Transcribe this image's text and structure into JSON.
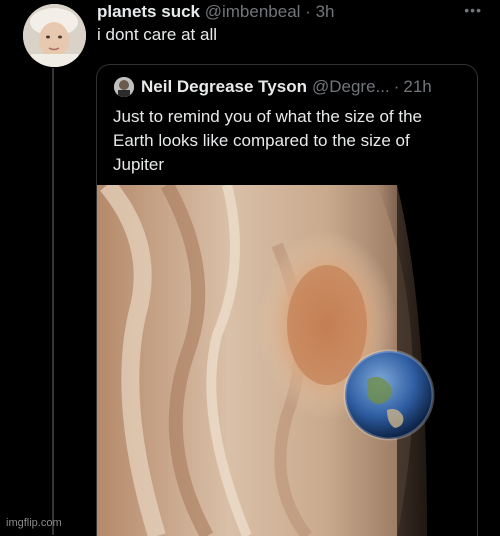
{
  "tweet": {
    "display_name": "planets suck",
    "handle": "@imbenbeal",
    "separator": "·",
    "time": "3h",
    "text": "i dont care at all",
    "more_icon": "more-dots-icon"
  },
  "quoted": {
    "display_name": "Neil Degrease Tyson",
    "handle": "@Degre...",
    "separator": "·",
    "time": "21h",
    "text": "Just to remind you of what the size of the Earth looks like compared to the size of Jupiter",
    "image_caption": "Jupiter with Earth for size comparison"
  },
  "watermark": "imgflip.com",
  "colors": {
    "background": "#000000",
    "text": "#e7e9ea",
    "muted": "#71767b",
    "border": "#2f3336"
  }
}
